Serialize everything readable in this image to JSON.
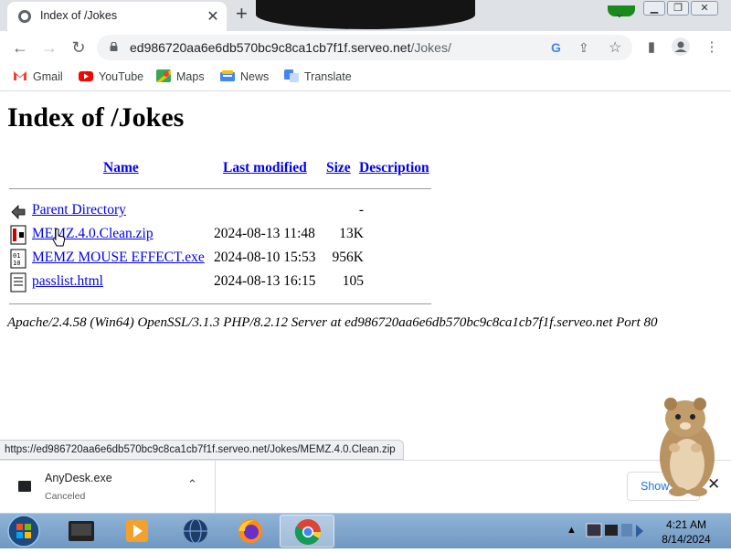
{
  "browser": {
    "tab_title": "Index of /Jokes",
    "url_host": "ed986720aa6e6db570bc9c8ca1cb7f1f.serveo.net",
    "url_path": "/Jokes/"
  },
  "bookmarks": [
    {
      "label": "Gmail",
      "icon": "gmail-icon"
    },
    {
      "label": "YouTube",
      "icon": "youtube-icon"
    },
    {
      "label": "Maps",
      "icon": "maps-icon"
    },
    {
      "label": "News",
      "icon": "news-icon"
    },
    {
      "label": "Translate",
      "icon": "translate-icon"
    }
  ],
  "page": {
    "title": "Index of /Jokes",
    "headers": {
      "name": "Name",
      "modified": "Last modified",
      "size": "Size",
      "description": "Description"
    },
    "entries": [
      {
        "name": "Parent Directory",
        "modified": "",
        "size": "-",
        "icon": "back-icon"
      },
      {
        "name": "MEMZ.4.0.Clean.zip",
        "modified": "2024-08-13 11:48",
        "size": "13K",
        "icon": "compressed-icon"
      },
      {
        "name": "MEMZ MOUSE EFFECT.exe",
        "modified": "2024-08-10 15:53",
        "size": "956K",
        "icon": "binary-icon"
      },
      {
        "name": "passlist.html",
        "modified": "2024-08-13 16:15",
        "size": "105",
        "icon": "text-icon"
      }
    ],
    "address": "Apache/2.4.58 (Win64) OpenSSL/3.1.3 PHP/8.2.12 Server at ed986720aa6e6db570bc9c8ca1cb7f1f.serveo.net Port 80"
  },
  "status_url": "https://ed986720aa6e6db570bc9c8ca1cb7f1f.serveo.net/Jokes/MEMZ.4.0.Clean.zip",
  "download": {
    "filename": "AnyDesk.exe",
    "status": "Canceled",
    "show_all": "Show all"
  },
  "taskbar": {
    "time": "4:21 AM",
    "date": "8/14/2024"
  },
  "colors": {
    "link": "#0000ee",
    "accent": "#1a73e8"
  }
}
